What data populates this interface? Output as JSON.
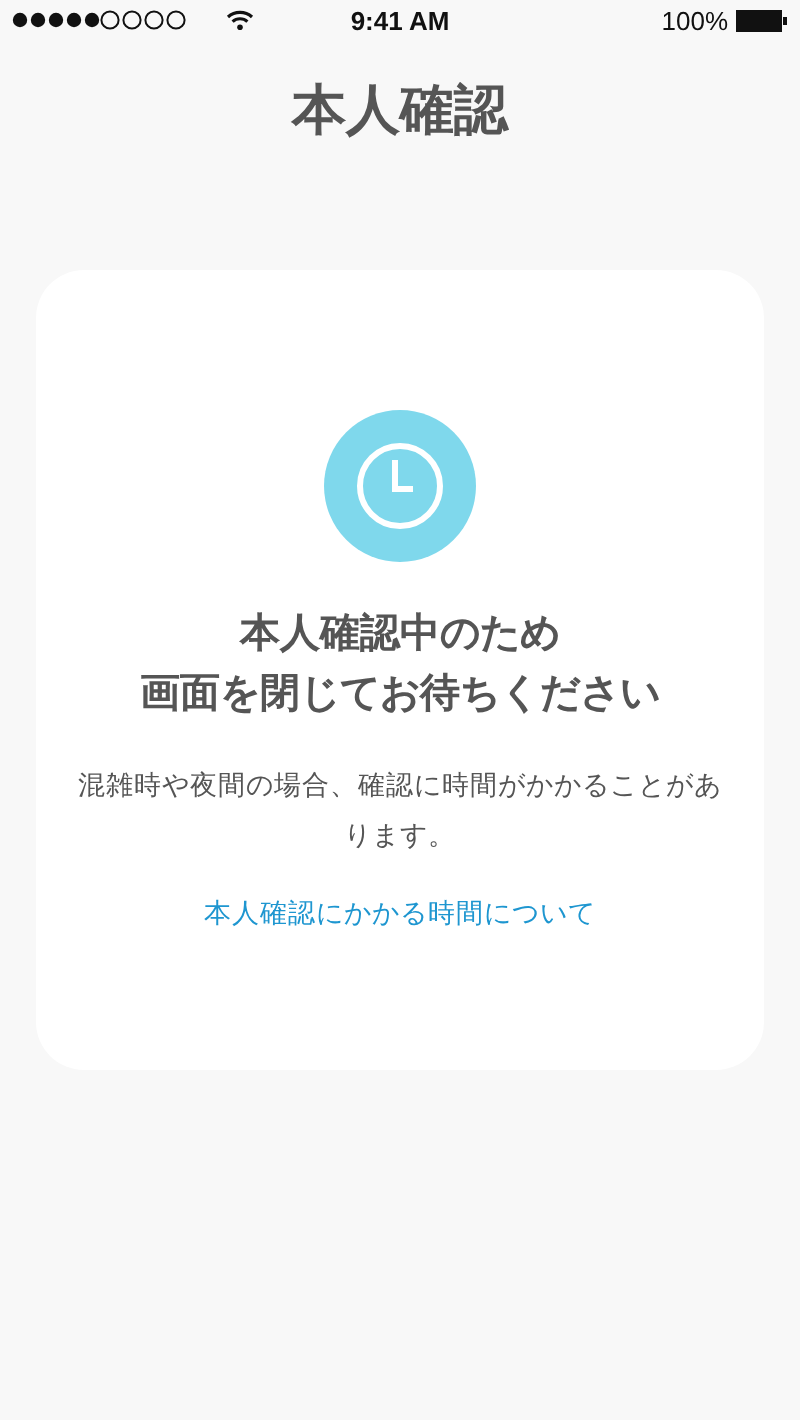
{
  "status_bar": {
    "time": "9:41 AM",
    "battery": "100%"
  },
  "title": "本人確認",
  "card": {
    "heading_lines": [
      "本人確認中のため",
      "画面を閉じてお待ちください"
    ],
    "message": "混雑時や夜間の場合、確認に時間がかかることがあります。",
    "link": "本人確認にかかる時間について"
  }
}
